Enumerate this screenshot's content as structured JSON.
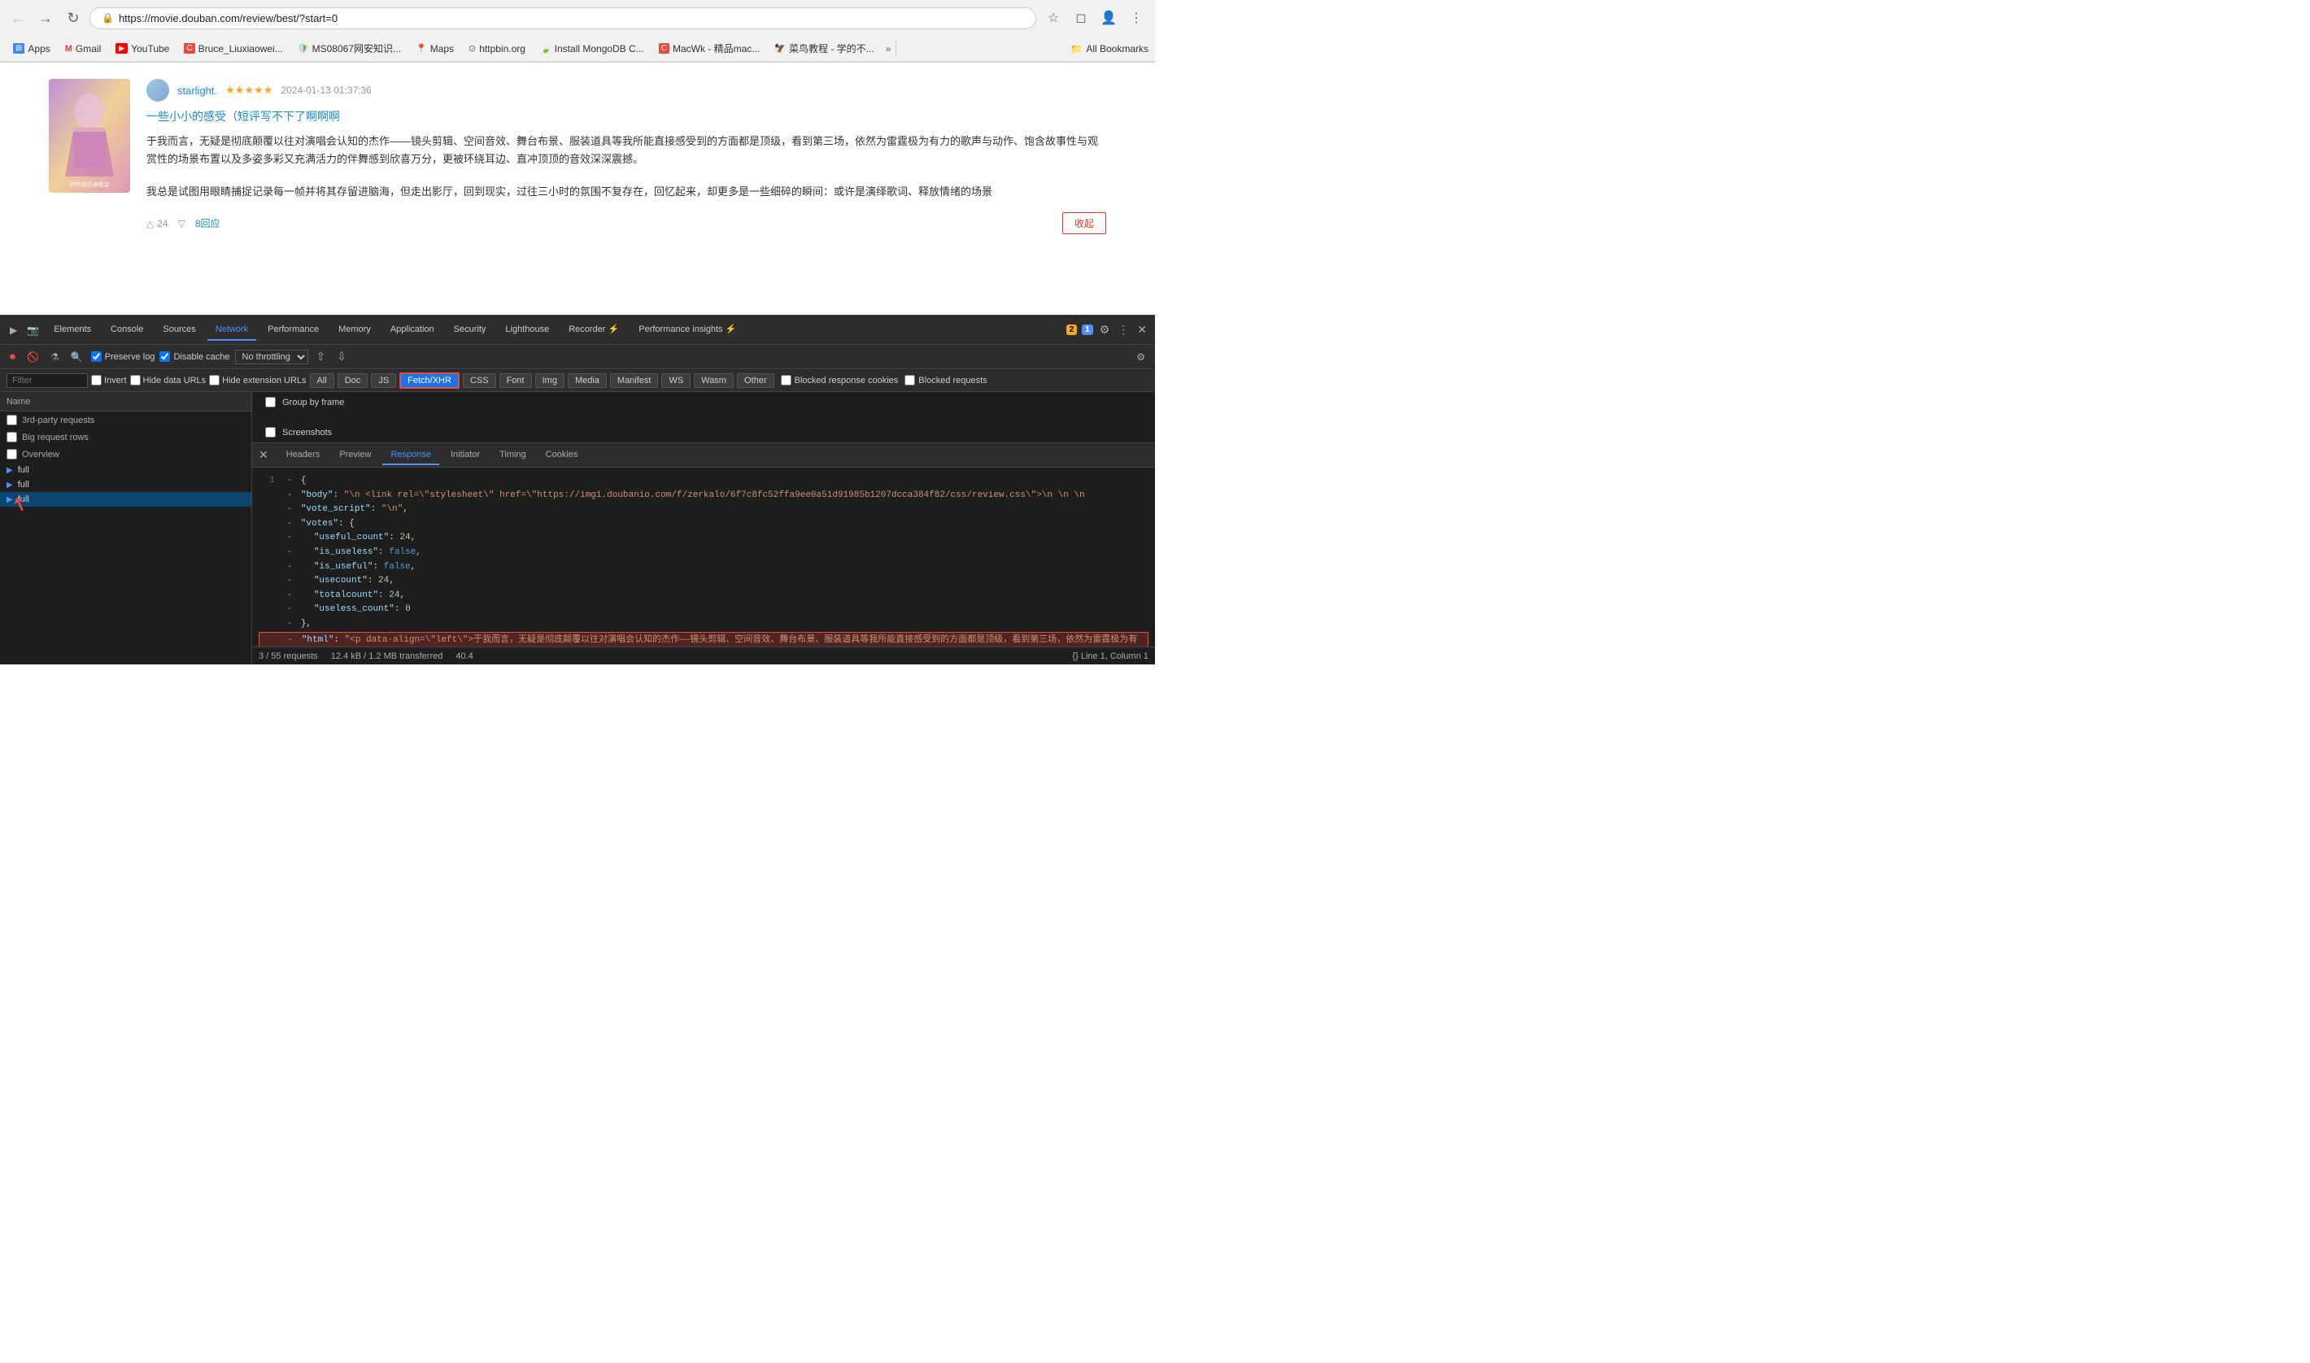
{
  "browser": {
    "back_btn": "←",
    "forward_btn": "→",
    "refresh_btn": "↻",
    "url": "https://movie.douban.com/review/best/?start=0",
    "star_icon": "☆",
    "bookmark_icon": "⊕",
    "profile_icon": "👤",
    "menu_icon": "⋮"
  },
  "bookmarks": [
    {
      "label": "Apps",
      "icon": "⊞",
      "color": "#4285f4"
    },
    {
      "label": "Gmail",
      "icon": "M",
      "color": "#EA4335"
    },
    {
      "label": "YouTube",
      "icon": "▶",
      "color": "#FF0000"
    },
    {
      "label": "Bruce_Liuxiaowei...",
      "icon": "C",
      "color": "#E84B3C"
    },
    {
      "label": "MS08067网安知识...",
      "icon": "🛡",
      "color": "#4CAF50"
    },
    {
      "label": "Maps",
      "icon": "📍",
      "color": "#4285f4"
    },
    {
      "label": "httpbin.org",
      "icon": "⊙",
      "color": "#666"
    },
    {
      "label": "Install MongoDB C...",
      "icon": "🍃",
      "color": "#4DB33D"
    },
    {
      "label": "MacWk - 精品mac...",
      "icon": "C",
      "color": "#E84B3C"
    },
    {
      "label": "菜鸟教程 - 学的不...",
      "icon": "🦅",
      "color": "#52c41a"
    }
  ],
  "bookmarks_more": "»",
  "all_bookmarks_label": "All Bookmarks",
  "review": {
    "poster_alt": "Taylor Swift Concert Movie Poster",
    "avatar_alt": "starlight avatar",
    "reviewer": "starlight.",
    "stars": "★★★★★",
    "date": "2024-01-13 01:37:36",
    "title": "一些小小的感受（短评写不下了啊啊啊",
    "text1": "于我而言，无疑是彻底颠覆以往对演唱会认知的杰作——镜头剪辑、空间音效、舞台布景、服装道具等我所能直接感受到的方面都是顶级，看到第三场，依然为雷霆极为有力的歌声与动作、饱含故事性与观赏性的场景布置以及多姿多彩又充满活力的伴舞感到欣喜万分，更被环绕耳边、直冲顶顶的音效深深震撼。",
    "text2": "我总是试图用眼睛捕捉记录每一帧并将其存留进脑海，但走出影厅，回到现实，过往三小时的氛围不复存在，回忆起来，却更多是一些细碎的瞬间：或许是演绎歌词、释放情绪的场景",
    "vote_up": "24",
    "vote_down": "",
    "reply": "8回应",
    "collapse_btn": "收起"
  },
  "devtools": {
    "tabs": [
      "Elements",
      "Console",
      "Sources",
      "Network",
      "Performance",
      "Memory",
      "Application",
      "Security",
      "Lighthouse",
      "Recorder ⚡",
      "Performance insights ⚡"
    ],
    "active_tab": "Network",
    "warning_count": "2",
    "info_count": "1",
    "close_icon": "✕",
    "settings_icon": "⚙",
    "more_icon": "⋮"
  },
  "network_controls": {
    "record_icon": "⏺",
    "clear_icon": "🚫",
    "filter_icon": "⚗",
    "search_icon": "🔍",
    "preserve_log": "Preserve log",
    "disable_cache": "Disable cache",
    "throttle": "No throttling",
    "upload_icon": "↑",
    "download_icon": "↓",
    "settings_icon": "⚙"
  },
  "filter_row": {
    "placeholder": "Filter",
    "invert": "Invert",
    "hide_data_urls": "Hide data URLs",
    "hide_extension_urls": "Hide extension URLs",
    "tags": [
      "All",
      "Doc",
      "JS",
      "Fetch/XHR",
      "CSS",
      "Font",
      "Img",
      "Media",
      "Manifest",
      "WS",
      "Wasm",
      "Other"
    ],
    "active_tag": "Fetch/XHR",
    "highlighted_tag": "Fetch/XHR",
    "blocked_response_cookies": "Blocked response cookies",
    "blocked_requests": "Blocked requests"
  },
  "request_options": [
    {
      "label": "3rd-party requests"
    },
    {
      "label": "Big request rows"
    },
    {
      "label": "Overview"
    }
  ],
  "right_options": {
    "group_by_frame": "Group by frame",
    "screenshots": "Screenshots"
  },
  "requests": [
    {
      "name": "full",
      "selected": false
    },
    {
      "name": "full",
      "selected": false
    },
    {
      "name": "full",
      "selected": true
    }
  ],
  "detail": {
    "close_icon": "✕",
    "tabs": [
      "Headers",
      "Preview",
      "Response",
      "Initiator",
      "Timing",
      "Cookies"
    ],
    "active_tab": "Response",
    "lines": [
      {
        "num": "1",
        "content": "{",
        "type": "normal"
      },
      {
        "num": "",
        "content": "    \"body\": \"\\n  <link rel=\\\"stylesheet\\\" href=\\\"https://img1.doubanio.com/f/zerkalo/6f7c8fc52ffa9ee0a51d91985b1207dcca384f82/css/review.css\\\">\\n  \\n  \\n",
        "type": "normal"
      },
      {
        "num": "",
        "content": "    \"vote_script\": \"\\n\",",
        "type": "normal"
      },
      {
        "num": "",
        "content": "    \"votes\": {",
        "type": "normal"
      },
      {
        "num": "",
        "content": "        \"useful_count\": 24,",
        "type": "normal"
      },
      {
        "num": "",
        "content": "        \"is_useless\": false,",
        "type": "normal"
      },
      {
        "num": "",
        "content": "        \"is_useful\": false,",
        "type": "normal"
      },
      {
        "num": "",
        "content": "        \"usecount\": 24,",
        "type": "normal"
      },
      {
        "num": "",
        "content": "        \"totalcount\": 24,",
        "type": "normal"
      },
      {
        "num": "",
        "content": "        \"useless_count\": 0",
        "type": "normal"
      },
      {
        "num": "",
        "content": "    },",
        "type": "normal"
      },
      {
        "num": "",
        "content": "    \"html\": \"<p data-align=\\\"left\\\">于我而言，无疑是彻底颠覆以往对演唱会认知的杰作——镜头剪辑、空间音效、舞台布景、服装道具等我所能直接感受到的方面都是顶级，看到第三场，依然为雷霆极为有",
        "type": "highlighted"
      }
    ],
    "line_indicator": "Line 1, Column 1",
    "json_icon": "{}"
  },
  "status_bar": {
    "requests": "3 / 55 requests",
    "size": "12.4 kB / 1.2 MB transferred",
    "time": "40.4"
  }
}
